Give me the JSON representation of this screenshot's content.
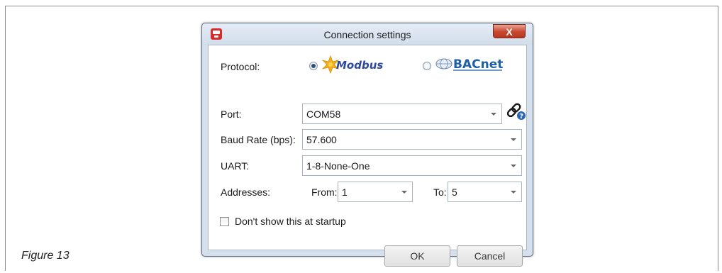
{
  "figure": {
    "caption": "Figure 13"
  },
  "dialog": {
    "title": "Connection settings",
    "close_label": "X",
    "protocol": {
      "label": "Protocol:",
      "options": [
        {
          "name": "Modbus",
          "selected": true
        },
        {
          "name": "BACnet",
          "selected": false
        }
      ]
    },
    "port": {
      "label": "Port:",
      "value": "COM58"
    },
    "baud": {
      "label": "Baud Rate (bps):",
      "value": "57.600"
    },
    "uart": {
      "label": "UART:",
      "value": "1-8-None-One"
    },
    "addresses": {
      "label": "Addresses:",
      "from_label": "From:",
      "from_value": "1",
      "to_label": "To:",
      "to_value": "5"
    },
    "startup_checkbox": {
      "label": "Don't show this at startup",
      "checked": false
    },
    "ok_label": "OK",
    "cancel_label": "Cancel"
  },
  "colors": {
    "close_button": "#c7462e",
    "dialog_frame": "#d6e0ec",
    "modbus_text": "#2b4aa0",
    "bacnet_text": "#1f5fa8"
  }
}
